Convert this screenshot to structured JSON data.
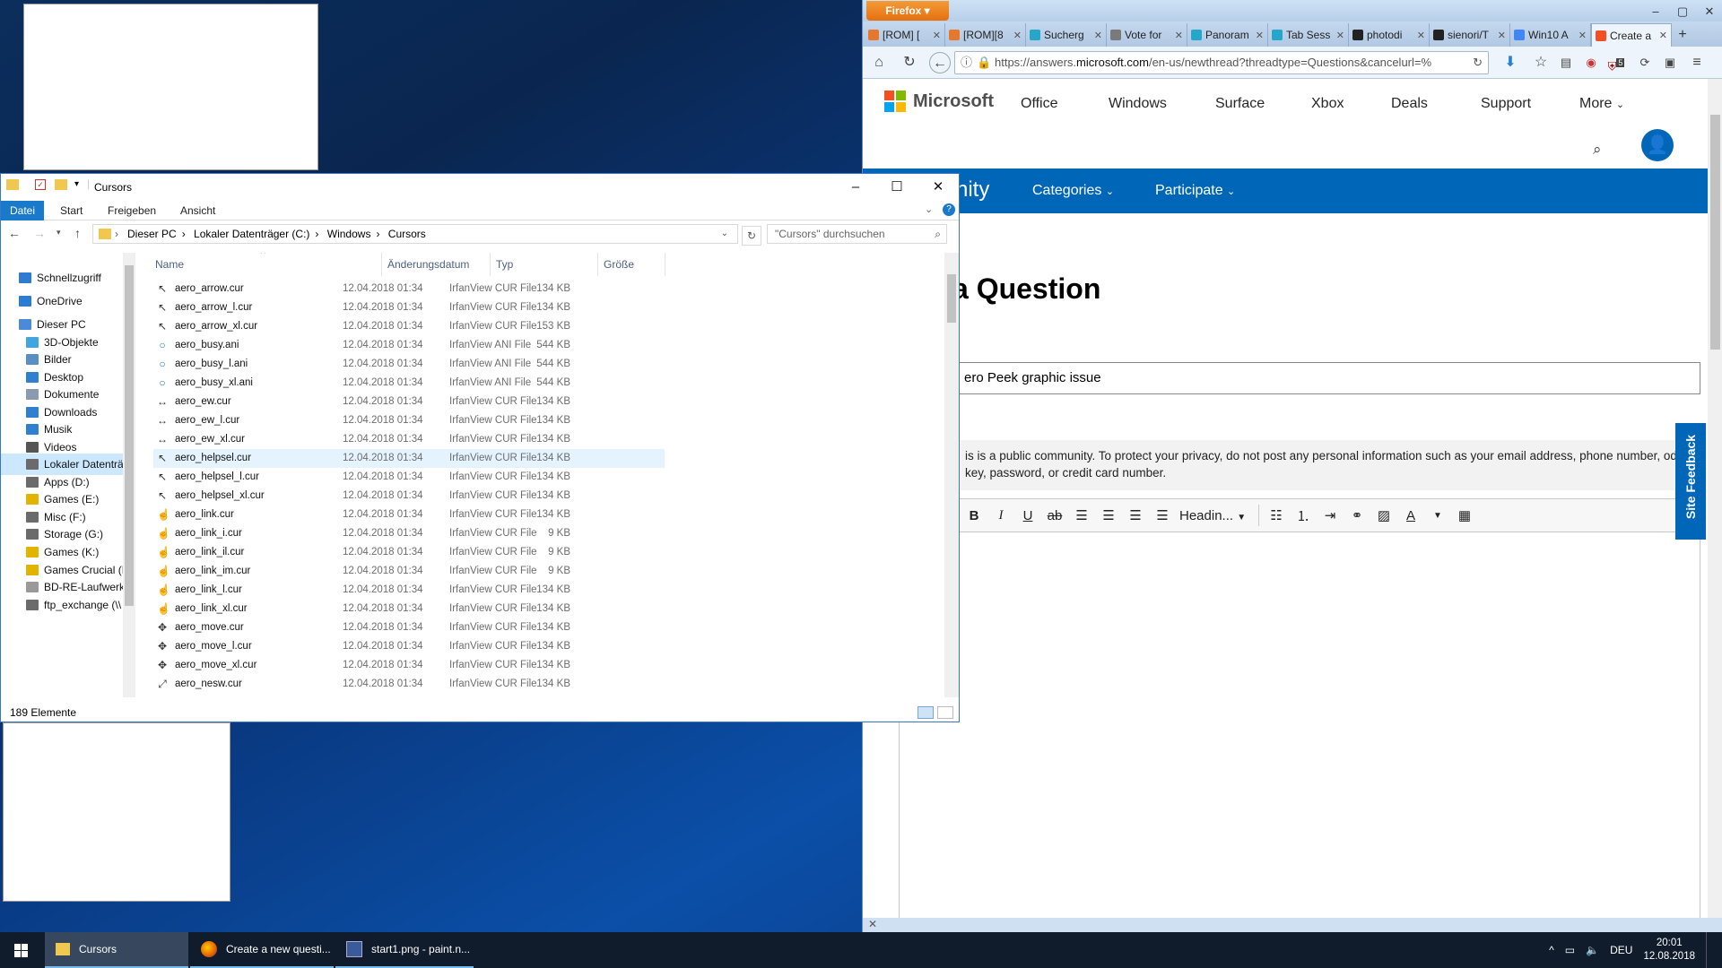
{
  "firefox": {
    "menu_label": "Firefox",
    "tabs": [
      {
        "title": "[ROM] [",
        "fav": "#e8772e"
      },
      {
        "title": "[ROM][8",
        "fav": "#e8772e"
      },
      {
        "title": "Sucherg",
        "fav": "#26a6c9"
      },
      {
        "title": "Vote for",
        "fav": "#7a7a7a"
      },
      {
        "title": "Panoram",
        "fav": "#26a6c9"
      },
      {
        "title": "Tab Sess",
        "fav": "#26a6c9"
      },
      {
        "title": "photodi",
        "fav": "#222222"
      },
      {
        "title": "sienori/T",
        "fav": "#222222"
      },
      {
        "title": "Win10 A",
        "fav": "#4285f4"
      },
      {
        "title": "Create a",
        "fav": "#f25022"
      }
    ],
    "url_prefix": "https://answers.",
    "url_domain": "microsoft.com",
    "url_rest": "/en-us/newthread?threadtype=Questions&cancelurl=%",
    "badge": "5"
  },
  "ms": {
    "logo": "Microsoft",
    "nav": [
      "Office",
      "Windows",
      "Surface",
      "Xbox",
      "Deals",
      "Support",
      "More"
    ],
    "blue_left": "nity",
    "blue_nav": [
      "Categories",
      "Participate"
    ],
    "title": "a Question",
    "subject": "ero Peek graphic issue",
    "notice": "is is a public community. To protect your privacy, do not post any personal information such as your email address, phone number, oduct key, password, or credit card number.",
    "heading_select": "Headin...",
    "feedback": "Site Feedback"
  },
  "explorer": {
    "title": "Cursors",
    "ribbon": [
      "Datei",
      "Start",
      "Freigeben",
      "Ansicht"
    ],
    "path": [
      "Dieser PC",
      "Lokaler Datenträger (C:)",
      "Windows",
      "Cursors"
    ],
    "search_placeholder": "\"Cursors\" durchsuchen",
    "columns": [
      "Name",
      "Änderungsdatum",
      "Typ",
      "Größe"
    ],
    "nav": [
      {
        "label": "Schnellzugriff",
        "color": "#2d7bd3",
        "indent": 0
      },
      {
        "label": "OneDrive",
        "color": "#2d7bd3",
        "indent": 0
      },
      {
        "label": "Dieser PC",
        "color": "#4a8ad8",
        "indent": 0
      },
      {
        "label": "3D-Objekte",
        "color": "#3fa6e0",
        "indent": 1
      },
      {
        "label": "Bilder",
        "color": "#5a8fc4",
        "indent": 1
      },
      {
        "label": "Desktop",
        "color": "#2f80d0",
        "indent": 1
      },
      {
        "label": "Dokumente",
        "color": "#8a9bb0",
        "indent": 1
      },
      {
        "label": "Downloads",
        "color": "#2f80d0",
        "indent": 1
      },
      {
        "label": "Musik",
        "color": "#2f80d0",
        "indent": 1
      },
      {
        "label": "Videos",
        "color": "#555555",
        "indent": 1
      },
      {
        "label": "Lokaler Datenträ",
        "color": "#6b6b6b",
        "indent": 1
      },
      {
        "label": "Apps (D:)",
        "color": "#6b6b6b",
        "indent": 1
      },
      {
        "label": "Games (E:)",
        "color": "#e2b400",
        "indent": 1
      },
      {
        "label": "Misc (F:)",
        "color": "#6b6b6b",
        "indent": 1
      },
      {
        "label": "Storage (G:)",
        "color": "#6b6b6b",
        "indent": 1
      },
      {
        "label": "Games (K:)",
        "color": "#e2b400",
        "indent": 1
      },
      {
        "label": "Games Crucial (I",
        "color": "#e2b400",
        "indent": 1
      },
      {
        "label": "BD-RE-Laufwerk",
        "color": "#9a9a9a",
        "indent": 1
      },
      {
        "label": "ftp_exchange (\\\\",
        "color": "#6b6b6b",
        "indent": 1
      }
    ],
    "files": [
      {
        "name": "aero_arrow.cur",
        "date": "12.04.2018 01:34",
        "type": "IrfanView CUR File",
        "size": "134 KB",
        "glyph": "↖"
      },
      {
        "name": "aero_arrow_l.cur",
        "date": "12.04.2018 01:34",
        "type": "IrfanView CUR File",
        "size": "134 KB",
        "glyph": "↖"
      },
      {
        "name": "aero_arrow_xl.cur",
        "date": "12.04.2018 01:34",
        "type": "IrfanView CUR File",
        "size": "153 KB",
        "glyph": "↖"
      },
      {
        "name": "aero_busy.ani",
        "date": "12.04.2018 01:34",
        "type": "IrfanView ANI File",
        "size": "544 KB",
        "glyph": "○"
      },
      {
        "name": "aero_busy_l.ani",
        "date": "12.04.2018 01:34",
        "type": "IrfanView ANI File",
        "size": "544 KB",
        "glyph": "○"
      },
      {
        "name": "aero_busy_xl.ani",
        "date": "12.04.2018 01:34",
        "type": "IrfanView ANI File",
        "size": "544 KB",
        "glyph": "○"
      },
      {
        "name": "aero_ew.cur",
        "date": "12.04.2018 01:34",
        "type": "IrfanView CUR File",
        "size": "134 KB",
        "glyph": "↔"
      },
      {
        "name": "aero_ew_l.cur",
        "date": "12.04.2018 01:34",
        "type": "IrfanView CUR File",
        "size": "134 KB",
        "glyph": "↔"
      },
      {
        "name": "aero_ew_xl.cur",
        "date": "12.04.2018 01:34",
        "type": "IrfanView CUR File",
        "size": "134 KB",
        "glyph": "↔"
      },
      {
        "name": "aero_helpsel.cur",
        "date": "12.04.2018 01:34",
        "type": "IrfanView CUR File",
        "size": "134 KB",
        "glyph": "↖"
      },
      {
        "name": "aero_helpsel_l.cur",
        "date": "12.04.2018 01:34",
        "type": "IrfanView CUR File",
        "size": "134 KB",
        "glyph": "↖"
      },
      {
        "name": "aero_helpsel_xl.cur",
        "date": "12.04.2018 01:34",
        "type": "IrfanView CUR File",
        "size": "134 KB",
        "glyph": "↖"
      },
      {
        "name": "aero_link.cur",
        "date": "12.04.2018 01:34",
        "type": "IrfanView CUR File",
        "size": "134 KB",
        "glyph": "☝"
      },
      {
        "name": "aero_link_i.cur",
        "date": "12.04.2018 01:34",
        "type": "IrfanView CUR File",
        "size": "9 KB",
        "glyph": "☝"
      },
      {
        "name": "aero_link_il.cur",
        "date": "12.04.2018 01:34",
        "type": "IrfanView CUR File",
        "size": "9 KB",
        "glyph": "☝"
      },
      {
        "name": "aero_link_im.cur",
        "date": "12.04.2018 01:34",
        "type": "IrfanView CUR File",
        "size": "9 KB",
        "glyph": "☝"
      },
      {
        "name": "aero_link_l.cur",
        "date": "12.04.2018 01:34",
        "type": "IrfanView CUR File",
        "size": "134 KB",
        "glyph": "☝"
      },
      {
        "name": "aero_link_xl.cur",
        "date": "12.04.2018 01:34",
        "type": "IrfanView CUR File",
        "size": "134 KB",
        "glyph": "☝"
      },
      {
        "name": "aero_move.cur",
        "date": "12.04.2018 01:34",
        "type": "IrfanView CUR File",
        "size": "134 KB",
        "glyph": "✥"
      },
      {
        "name": "aero_move_l.cur",
        "date": "12.04.2018 01:34",
        "type": "IrfanView CUR File",
        "size": "134 KB",
        "glyph": "✥"
      },
      {
        "name": "aero_move_xl.cur",
        "date": "12.04.2018 01:34",
        "type": "IrfanView CUR File",
        "size": "134 KB",
        "glyph": "✥"
      },
      {
        "name": "aero_nesw.cur",
        "date": "12.04.2018 01:34",
        "type": "IrfanView CUR File",
        "size": "134 KB",
        "glyph": "⤢"
      }
    ],
    "status": "189 Elemente"
  },
  "taskbar": {
    "items": [
      "Cursors",
      "Create a new questi...",
      "start1.png - paint.n..."
    ],
    "lang": "DEU",
    "time": "20:01",
    "date": "12.08.2018"
  }
}
